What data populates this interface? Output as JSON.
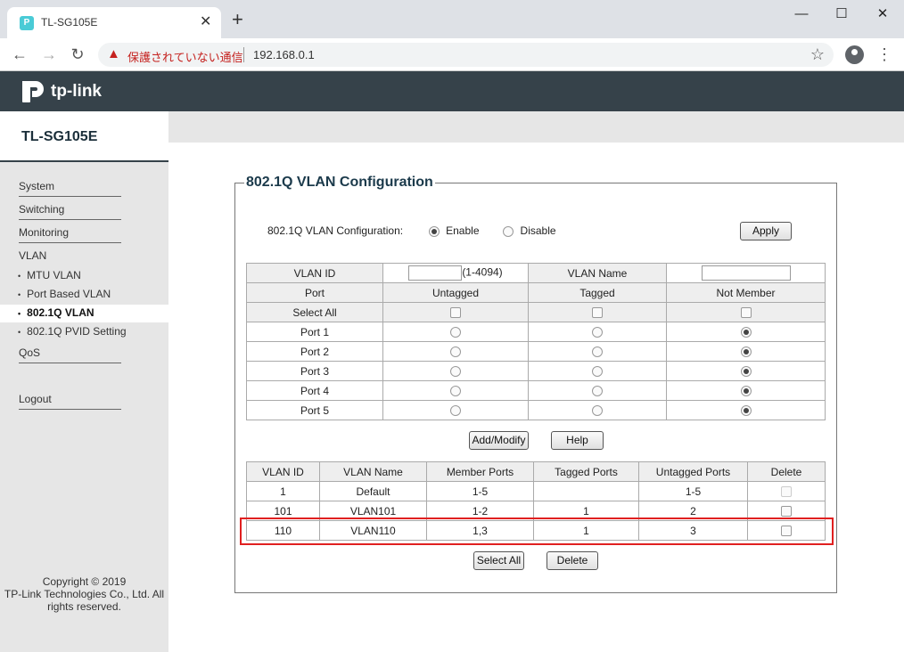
{
  "browser": {
    "tab_title": "TL-SG105E",
    "tab_favicon_letter": "P",
    "new_tab_icon": "+",
    "security_warning": "保護されていない通信",
    "url": "192.168.0.1",
    "window_buttons": [
      "—",
      "☐",
      "✕"
    ]
  },
  "header": {
    "brand": "tp-link",
    "model": "TL-SG105E"
  },
  "sidebar": {
    "items": [
      {
        "label": "System"
      },
      {
        "label": "Switching"
      },
      {
        "label": "Monitoring"
      },
      {
        "label": "VLAN"
      }
    ],
    "vlan_sub": [
      {
        "label": "MTU VLAN",
        "active": false
      },
      {
        "label": "Port Based VLAN",
        "active": false
      },
      {
        "label": "802.1Q VLAN",
        "active": true
      },
      {
        "label": "802.1Q PVID Setting",
        "active": false
      }
    ],
    "qos": "QoS",
    "logout": "Logout",
    "copyright_line1": "Copyright © 2019",
    "copyright_line2": "TP-Link Technologies Co., Ltd. All",
    "copyright_line3": "rights reserved."
  },
  "main": {
    "title": "802.1Q VLAN Configuration",
    "config_label": "802.1Q VLAN Configuration:",
    "enable_label": "Enable",
    "disable_label": "Disable",
    "enabled": true,
    "apply_label": "Apply",
    "vlan_id_label": "VLAN ID",
    "vlan_id_hint": "(1-4094)",
    "vlan_id_value": "",
    "vlan_name_label": "VLAN Name",
    "vlan_name_value": "",
    "col_port": "Port",
    "col_untagged": "Untagged",
    "col_tagged": "Tagged",
    "col_not_member": "Not Member",
    "select_all_row": "Select All",
    "ports": [
      {
        "name": "Port 1",
        "selection": "not_member"
      },
      {
        "name": "Port 2",
        "selection": "not_member"
      },
      {
        "name": "Port 3",
        "selection": "not_member"
      },
      {
        "name": "Port 4",
        "selection": "not_member"
      },
      {
        "name": "Port 5",
        "selection": "not_member"
      }
    ],
    "add_modify_label": "Add/Modify",
    "help_label": "Help",
    "vlan_table": {
      "headers": [
        "VLAN ID",
        "VLAN Name",
        "Member Ports",
        "Tagged Ports",
        "Untagged Ports",
        "Delete"
      ],
      "rows": [
        {
          "id": "1",
          "name": "Default",
          "members": "1-5",
          "tagged": "",
          "untagged": "1-5",
          "deletable": false
        },
        {
          "id": "101",
          "name": "VLAN101",
          "members": "1-2",
          "tagged": "1",
          "untagged": "2",
          "deletable": true
        },
        {
          "id": "110",
          "name": "VLAN110",
          "members": "1,3",
          "tagged": "1",
          "untagged": "3",
          "deletable": true
        }
      ]
    },
    "select_all_label": "Select All",
    "delete_label": "Delete",
    "highlight_color": "#e02020"
  }
}
